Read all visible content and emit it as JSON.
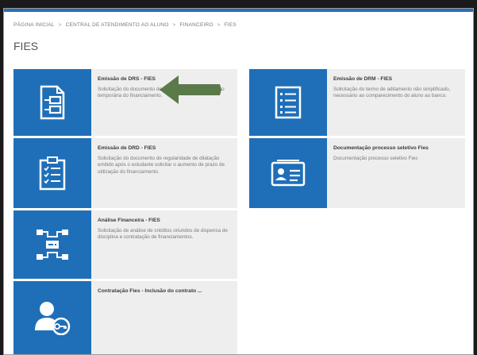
{
  "breadcrumb": {
    "items": [
      "PÁGINA INICIAL",
      "CENTRAL DE ATENDIMENTO AO ALUNO",
      "FINANCEIRO",
      "FIES"
    ],
    "separator": ">"
  },
  "page_title": "FIES",
  "cards": [
    {
      "title": "Emissão de DRS - FIES",
      "description": "Solicitação do documento de regularidade de Suspensão temporária do financiamento.",
      "icon": "document-form-icon"
    },
    {
      "title": "Emissão de DRM - FIES",
      "description": "Solicitação do termo de aditamento não simplificado, necessário ao comparecimento do aluno ao banco.",
      "icon": "list-document-icon"
    },
    {
      "title": "Emissão de DRD - FIES",
      "description": "Solicitação do documento de regularidade de dilatação emitido após o estudante solicitar o aumento de prazo de utilização do financiamento.",
      "icon": "clipboard-checklist-icon"
    },
    {
      "title": "Documentação processo seletivo Fies",
      "description": "Documentação processo seletivo Fies",
      "icon": "id-card-icon"
    },
    {
      "title": "Análise Financeira - FIES",
      "description": "Solicitação de análise de créditos oriundos de dispensa de disciplina e contratação de financiamentos.",
      "icon": "network-flow-icon"
    },
    {
      "title": "Contratação Fies - Inclusão do contrato ...",
      "description": "",
      "icon": "user-key-icon"
    }
  ],
  "colors": {
    "tile_blue": "#1f6fb8",
    "card_bg": "#eeeeee",
    "annotation_arrow": "#5a7a4a"
  }
}
